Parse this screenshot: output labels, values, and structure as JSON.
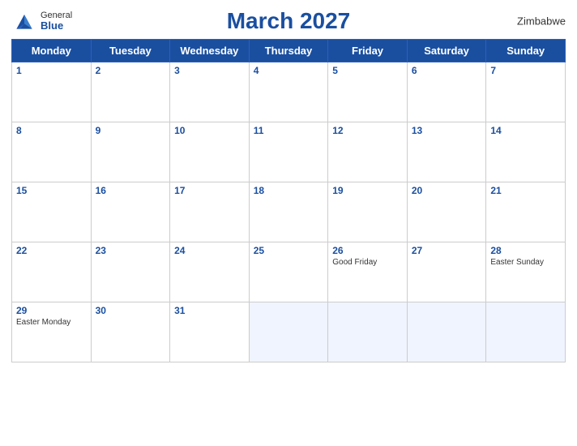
{
  "header": {
    "title": "March 2027",
    "country": "Zimbabwe",
    "logo": {
      "general": "General",
      "blue": "Blue"
    }
  },
  "weekdays": [
    "Monday",
    "Tuesday",
    "Wednesday",
    "Thursday",
    "Friday",
    "Saturday",
    "Sunday"
  ],
  "weeks": [
    [
      {
        "date": "1",
        "holiday": ""
      },
      {
        "date": "2",
        "holiday": ""
      },
      {
        "date": "3",
        "holiday": ""
      },
      {
        "date": "4",
        "holiday": ""
      },
      {
        "date": "5",
        "holiday": ""
      },
      {
        "date": "6",
        "holiday": ""
      },
      {
        "date": "7",
        "holiday": ""
      }
    ],
    [
      {
        "date": "8",
        "holiday": ""
      },
      {
        "date": "9",
        "holiday": ""
      },
      {
        "date": "10",
        "holiday": ""
      },
      {
        "date": "11",
        "holiday": ""
      },
      {
        "date": "12",
        "holiday": ""
      },
      {
        "date": "13",
        "holiday": ""
      },
      {
        "date": "14",
        "holiday": ""
      }
    ],
    [
      {
        "date": "15",
        "holiday": ""
      },
      {
        "date": "16",
        "holiday": ""
      },
      {
        "date": "17",
        "holiday": ""
      },
      {
        "date": "18",
        "holiday": ""
      },
      {
        "date": "19",
        "holiday": ""
      },
      {
        "date": "20",
        "holiday": ""
      },
      {
        "date": "21",
        "holiday": ""
      }
    ],
    [
      {
        "date": "22",
        "holiday": ""
      },
      {
        "date": "23",
        "holiday": ""
      },
      {
        "date": "24",
        "holiday": ""
      },
      {
        "date": "25",
        "holiday": ""
      },
      {
        "date": "26",
        "holiday": "Good Friday"
      },
      {
        "date": "27",
        "holiday": ""
      },
      {
        "date": "28",
        "holiday": "Easter Sunday"
      }
    ],
    [
      {
        "date": "29",
        "holiday": "Easter Monday"
      },
      {
        "date": "30",
        "holiday": ""
      },
      {
        "date": "31",
        "holiday": ""
      },
      {
        "date": "",
        "holiday": ""
      },
      {
        "date": "",
        "holiday": ""
      },
      {
        "date": "",
        "holiday": ""
      },
      {
        "date": "",
        "holiday": ""
      }
    ]
  ]
}
